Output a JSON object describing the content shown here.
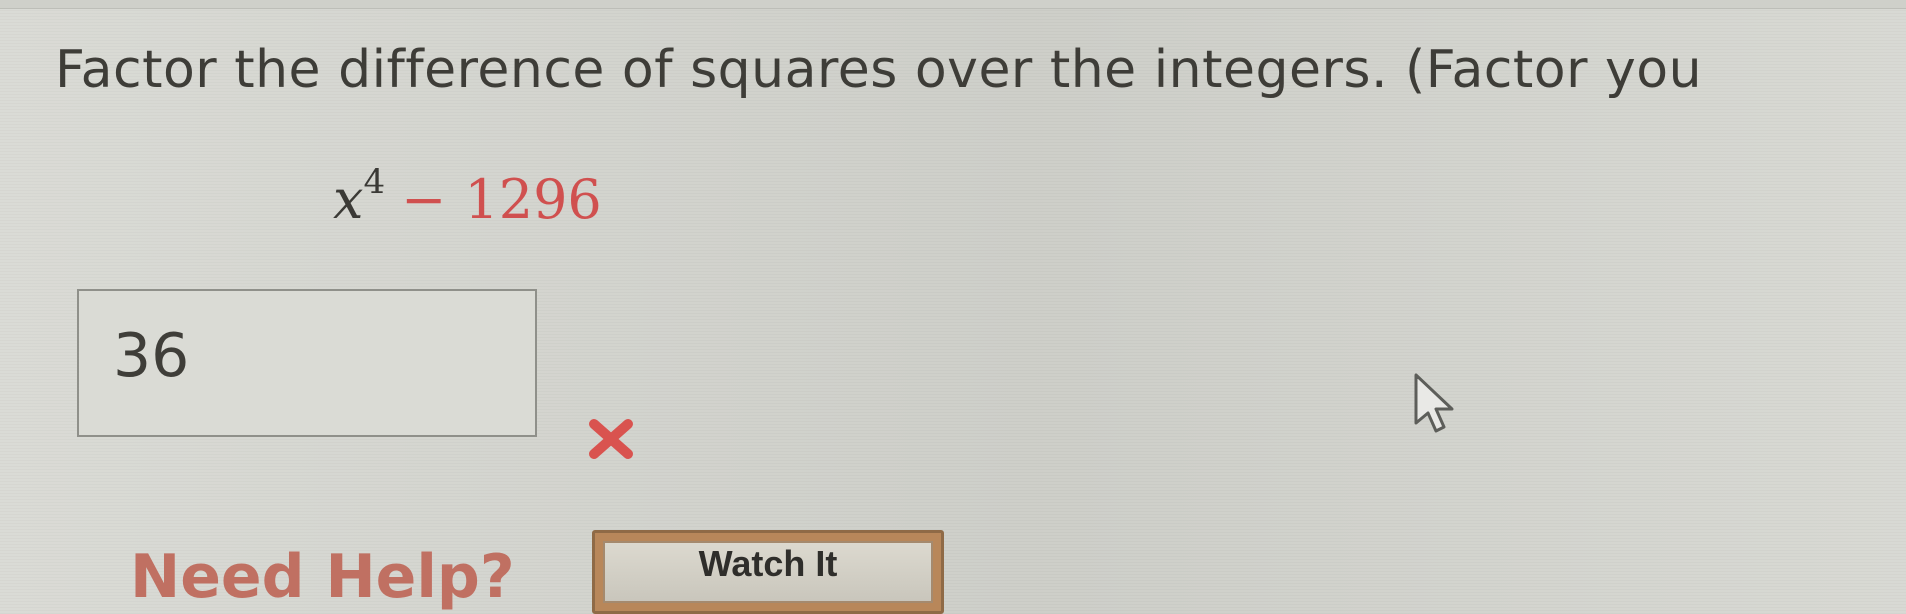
{
  "question": {
    "text": "Factor the difference of squares over the integers. (Factor you"
  },
  "expression": {
    "variable": "x",
    "exponent": "4",
    "operator": "−",
    "constant": "1296"
  },
  "answer": {
    "value": "36",
    "status": "incorrect",
    "status_icon": "cross-icon",
    "status_color": "#d9534f"
  },
  "help": {
    "label": "Need Help?",
    "watch_button_label": "Watch It"
  },
  "colors": {
    "page_bg": "#d6d7d1",
    "accent_red": "#d0504f",
    "help_text": "#c07062",
    "button_frame": "#b8875a"
  }
}
